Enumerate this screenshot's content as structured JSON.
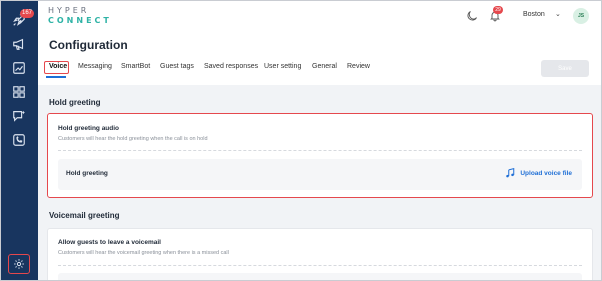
{
  "app": {
    "logo_line1": "HYPER",
    "logo_line2": "CONNECT",
    "location": "Boston",
    "avatar_initials": "JS",
    "notifications_count": "29",
    "sidebar_badge": "167"
  },
  "sidebar": {
    "items": [
      {
        "icon": "rocket-icon"
      },
      {
        "icon": "megaphone-icon"
      },
      {
        "icon": "image-chart-icon"
      },
      {
        "icon": "grid-icon"
      },
      {
        "icon": "chat-star-icon"
      },
      {
        "icon": "phone-icon"
      },
      {
        "icon": "settings-icon"
      }
    ]
  },
  "page": {
    "title": "Configuration",
    "save_label": "Save"
  },
  "tabs": [
    {
      "label": "Voice",
      "active": true
    },
    {
      "label": "Messaging"
    },
    {
      "label": "SmartBot"
    },
    {
      "label": "Guest tags"
    },
    {
      "label": "Saved responses"
    },
    {
      "label": "User setting"
    },
    {
      "label": "General"
    },
    {
      "label": "Review"
    }
  ],
  "hold": {
    "section_title": "Hold greeting",
    "card_title": "Hold greeting audio",
    "card_desc": "Customers will hear the hold greeting when the call is on hold",
    "row_label": "Hold greeting",
    "upload_label": "Upload voice file"
  },
  "voicemail": {
    "section_title": "Voicemail greeting",
    "card_title": "Allow guests to leave a voicemail",
    "card_desc": "Customers will hear the voicemail greeting when there is a missed call"
  },
  "colors": {
    "sidebar": "#18355f",
    "accent": "#1f6fd6",
    "highlight": "#e5484d",
    "brand_teal": "#2fb3a6"
  }
}
